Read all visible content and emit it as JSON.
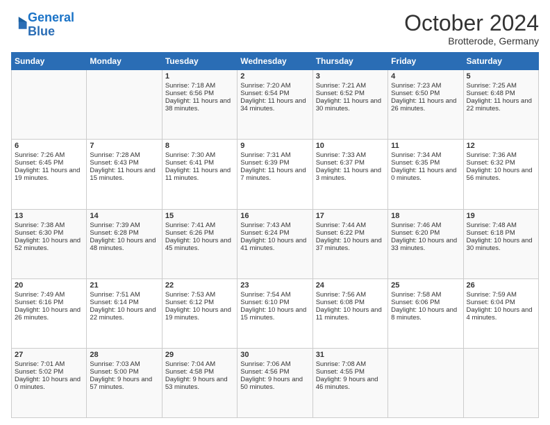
{
  "header": {
    "logo_line1": "General",
    "logo_line2": "Blue",
    "month": "October 2024",
    "location": "Brotterode, Germany"
  },
  "weekdays": [
    "Sunday",
    "Monday",
    "Tuesday",
    "Wednesday",
    "Thursday",
    "Friday",
    "Saturday"
  ],
  "weeks": [
    [
      {
        "day": "",
        "info": ""
      },
      {
        "day": "",
        "info": ""
      },
      {
        "day": "1",
        "info": "Sunrise: 7:18 AM\nSunset: 6:56 PM\nDaylight: 11 hours and 38 minutes."
      },
      {
        "day": "2",
        "info": "Sunrise: 7:20 AM\nSunset: 6:54 PM\nDaylight: 11 hours and 34 minutes."
      },
      {
        "day": "3",
        "info": "Sunrise: 7:21 AM\nSunset: 6:52 PM\nDaylight: 11 hours and 30 minutes."
      },
      {
        "day": "4",
        "info": "Sunrise: 7:23 AM\nSunset: 6:50 PM\nDaylight: 11 hours and 26 minutes."
      },
      {
        "day": "5",
        "info": "Sunrise: 7:25 AM\nSunset: 6:48 PM\nDaylight: 11 hours and 22 minutes."
      }
    ],
    [
      {
        "day": "6",
        "info": "Sunrise: 7:26 AM\nSunset: 6:45 PM\nDaylight: 11 hours and 19 minutes."
      },
      {
        "day": "7",
        "info": "Sunrise: 7:28 AM\nSunset: 6:43 PM\nDaylight: 11 hours and 15 minutes."
      },
      {
        "day": "8",
        "info": "Sunrise: 7:30 AM\nSunset: 6:41 PM\nDaylight: 11 hours and 11 minutes."
      },
      {
        "day": "9",
        "info": "Sunrise: 7:31 AM\nSunset: 6:39 PM\nDaylight: 11 hours and 7 minutes."
      },
      {
        "day": "10",
        "info": "Sunrise: 7:33 AM\nSunset: 6:37 PM\nDaylight: 11 hours and 3 minutes."
      },
      {
        "day": "11",
        "info": "Sunrise: 7:34 AM\nSunset: 6:35 PM\nDaylight: 11 hours and 0 minutes."
      },
      {
        "day": "12",
        "info": "Sunrise: 7:36 AM\nSunset: 6:32 PM\nDaylight: 10 hours and 56 minutes."
      }
    ],
    [
      {
        "day": "13",
        "info": "Sunrise: 7:38 AM\nSunset: 6:30 PM\nDaylight: 10 hours and 52 minutes."
      },
      {
        "day": "14",
        "info": "Sunrise: 7:39 AM\nSunset: 6:28 PM\nDaylight: 10 hours and 48 minutes."
      },
      {
        "day": "15",
        "info": "Sunrise: 7:41 AM\nSunset: 6:26 PM\nDaylight: 10 hours and 45 minutes."
      },
      {
        "day": "16",
        "info": "Sunrise: 7:43 AM\nSunset: 6:24 PM\nDaylight: 10 hours and 41 minutes."
      },
      {
        "day": "17",
        "info": "Sunrise: 7:44 AM\nSunset: 6:22 PM\nDaylight: 10 hours and 37 minutes."
      },
      {
        "day": "18",
        "info": "Sunrise: 7:46 AM\nSunset: 6:20 PM\nDaylight: 10 hours and 33 minutes."
      },
      {
        "day": "19",
        "info": "Sunrise: 7:48 AM\nSunset: 6:18 PM\nDaylight: 10 hours and 30 minutes."
      }
    ],
    [
      {
        "day": "20",
        "info": "Sunrise: 7:49 AM\nSunset: 6:16 PM\nDaylight: 10 hours and 26 minutes."
      },
      {
        "day": "21",
        "info": "Sunrise: 7:51 AM\nSunset: 6:14 PM\nDaylight: 10 hours and 22 minutes."
      },
      {
        "day": "22",
        "info": "Sunrise: 7:53 AM\nSunset: 6:12 PM\nDaylight: 10 hours and 19 minutes."
      },
      {
        "day": "23",
        "info": "Sunrise: 7:54 AM\nSunset: 6:10 PM\nDaylight: 10 hours and 15 minutes."
      },
      {
        "day": "24",
        "info": "Sunrise: 7:56 AM\nSunset: 6:08 PM\nDaylight: 10 hours and 11 minutes."
      },
      {
        "day": "25",
        "info": "Sunrise: 7:58 AM\nSunset: 6:06 PM\nDaylight: 10 hours and 8 minutes."
      },
      {
        "day": "26",
        "info": "Sunrise: 7:59 AM\nSunset: 6:04 PM\nDaylight: 10 hours and 4 minutes."
      }
    ],
    [
      {
        "day": "27",
        "info": "Sunrise: 7:01 AM\nSunset: 5:02 PM\nDaylight: 10 hours and 0 minutes."
      },
      {
        "day": "28",
        "info": "Sunrise: 7:03 AM\nSunset: 5:00 PM\nDaylight: 9 hours and 57 minutes."
      },
      {
        "day": "29",
        "info": "Sunrise: 7:04 AM\nSunset: 4:58 PM\nDaylight: 9 hours and 53 minutes."
      },
      {
        "day": "30",
        "info": "Sunrise: 7:06 AM\nSunset: 4:56 PM\nDaylight: 9 hours and 50 minutes."
      },
      {
        "day": "31",
        "info": "Sunrise: 7:08 AM\nSunset: 4:55 PM\nDaylight: 9 hours and 46 minutes."
      },
      {
        "day": "",
        "info": ""
      },
      {
        "day": "",
        "info": ""
      }
    ]
  ]
}
